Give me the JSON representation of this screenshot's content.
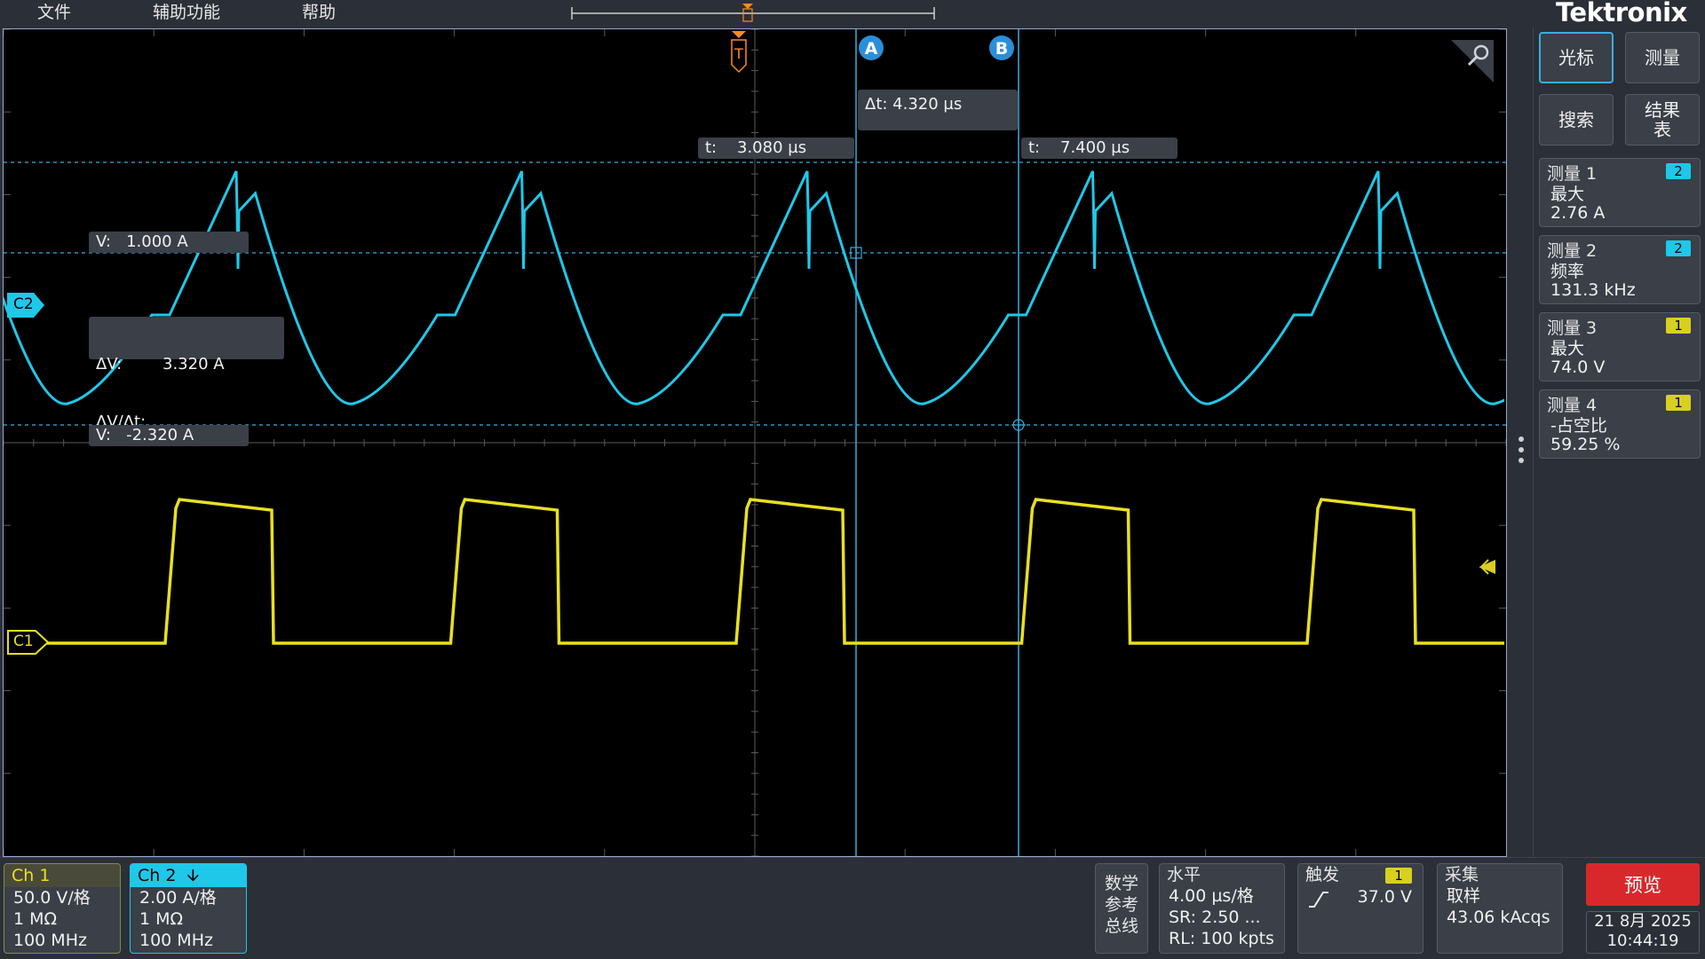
{
  "menu": {
    "file": "文件",
    "assist": "辅助功能",
    "help": "帮助"
  },
  "brand": "Tektronix",
  "side": {
    "cursor_btn": "光标",
    "measure_btn": "测量",
    "search_btn": "搜索",
    "results_btn_1": "结果",
    "results_btn_2": "表"
  },
  "measurements": [
    {
      "title": "测量 1",
      "source": "2",
      "name": "最大",
      "value": "2.76 A",
      "badge_color": "#1fc8e8"
    },
    {
      "title": "测量 2",
      "source": "2",
      "name": "频率",
      "value": "131.3 kHz",
      "badge_color": "#1fc8e8"
    },
    {
      "title": "测量 3",
      "source": "1",
      "name": "最大",
      "value": "74.0 V",
      "badge_color": "#d8d020"
    },
    {
      "title": "测量 4",
      "source": "1",
      "name": "-占空比",
      "value": "59.25 %",
      "badge_color": "#d8d020"
    }
  ],
  "cursor_readouts": {
    "marker_a": "A",
    "marker_b": "B",
    "delta_t": "Δt:  4.320 µs",
    "t_a": "t:    3.080 µs",
    "t_b": "t:    7.400 µs",
    "v_top": "V:   1.000 A",
    "delta_v": "ΔV:        3.320 A",
    "delta_v_dt": "ΔV/Δt:",
    "v_bottom": "V:   -2.320 A"
  },
  "trigger_marker": "T",
  "channel_markers": {
    "c1": "C1",
    "c2": "C2"
  },
  "channels": [
    {
      "header": "Ch 1",
      "scale": "50.0 V/格",
      "impedance": "1 MΩ",
      "bandwidth": "100 MHz",
      "color": "#d8d020"
    },
    {
      "header": "Ch 2",
      "scale": "2.00 A/格",
      "impedance": "1 MΩ",
      "bandwidth": "100 MHz",
      "color": "#1fc8e8"
    }
  ],
  "math_panel": {
    "l1": "数学",
    "l2": "参考",
    "l3": "总线"
  },
  "horizontal": {
    "title": "水平",
    "scale": "4.00 µs/格",
    "sr": "SR: 2.50 ...",
    "rl": "RL: 100 kpts"
  },
  "trigger": {
    "title": "触发",
    "source": "1",
    "level": "37.0 V"
  },
  "acquisition": {
    "title": "采集",
    "mode": "取样",
    "count": "43.06 kAcqs"
  },
  "preview_label": "预览",
  "date": "21 8月 2025",
  "time": "10:44:19"
}
